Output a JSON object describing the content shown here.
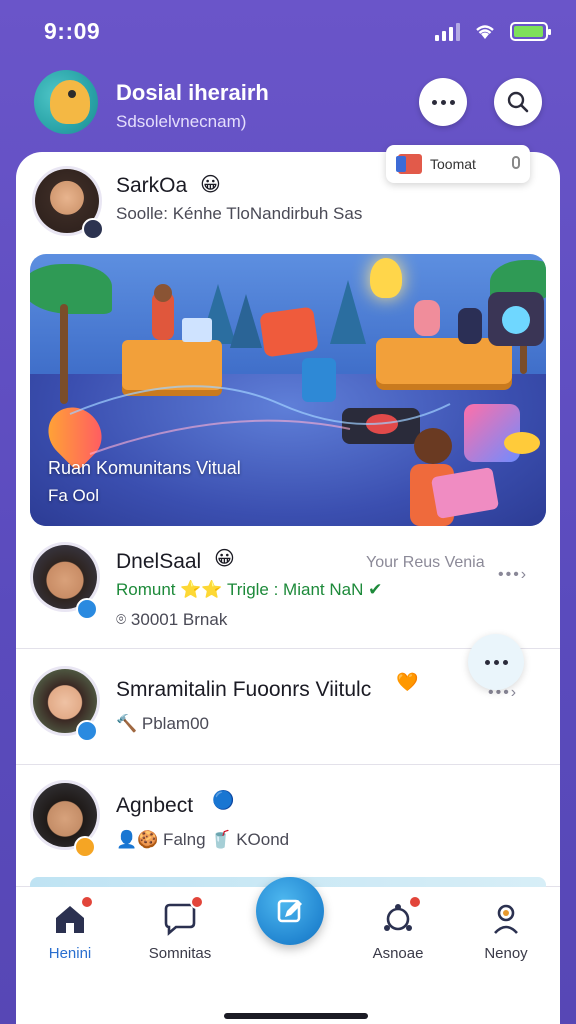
{
  "status_bar": {
    "time": "9::09",
    "battery_level": 0.95
  },
  "header": {
    "title": "Dosial iherairh",
    "subtitle": "Sdsolelvnecnam)",
    "more_icon": "more-horizontal-icon",
    "search_icon": "search-icon"
  },
  "toast": {
    "label": "Toomat",
    "icon": "translate-icon"
  },
  "feed": {
    "items": [
      {
        "name": "SarkOa",
        "emoji": "😀",
        "subtitle": "Soolle: Kénhe TloNandirbuh Sas"
      },
      {
        "name": "DnelSaal",
        "emoji": "😀",
        "extra": "Your Reus Venia",
        "subtitle": "Romunt ⭐⭐ Trigle : Miant NaN ✔",
        "meta": "⌾ 30001 Brnak"
      },
      {
        "name": "Smramitalin Fuoonrs Viitulc",
        "emoji": "🧡",
        "subtitle": "🔨 Pblam00"
      },
      {
        "name": "Agnbect",
        "emoji": "🔵",
        "subtitle": "👤🍪 Falng 🥤 KOond"
      }
    ],
    "hero": {
      "caption_line1": "Ruan Komunitans Vitual",
      "caption_line2": "Fa Ool"
    }
  },
  "bottom_nav": {
    "items": [
      {
        "label": "Henini",
        "icon": "home-icon",
        "active": true
      },
      {
        "label": "Somnitas",
        "icon": "chat-bubble-icon",
        "active": false
      },
      {
        "label": "Asnoae",
        "icon": "community-icon",
        "active": false
      },
      {
        "label": "Nenoy",
        "icon": "profile-icon",
        "active": false
      }
    ],
    "fab_icon": "compose-icon"
  },
  "colors": {
    "accent": "#2286d1",
    "background": "#5d4cc0",
    "badge_red": "#e2453a",
    "card": "#ffffff"
  }
}
